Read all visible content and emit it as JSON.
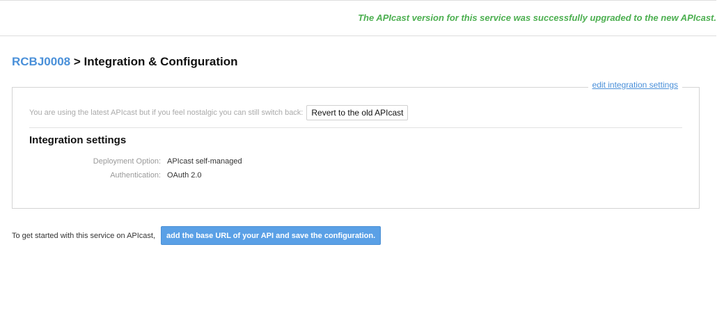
{
  "flash": {
    "message": "The APIcast version for this service was successfully upgraded to the new APIcast."
  },
  "header": {
    "service_name": "RCBJ0008",
    "separator": ">",
    "page_title": "Integration & Configuration"
  },
  "panel": {
    "edit_link": "edit integration settings",
    "switch_text": "You are using the latest APIcast but if you feel nostalgic you can still switch back:",
    "revert_button": "Revert to the old APIcast",
    "section_title": "Integration settings",
    "settings": [
      {
        "label": "Deployment Option:",
        "value": "APIcast self-managed"
      },
      {
        "label": "Authentication:",
        "value": "OAuth 2.0"
      }
    ]
  },
  "get_started": {
    "text": "To get started with this service on APIcast,",
    "button": "add the base URL of your API and save the configuration."
  },
  "colors": {
    "success": "#4caf50",
    "link": "#4a90d9",
    "primary_button": "#5aa0e6"
  }
}
